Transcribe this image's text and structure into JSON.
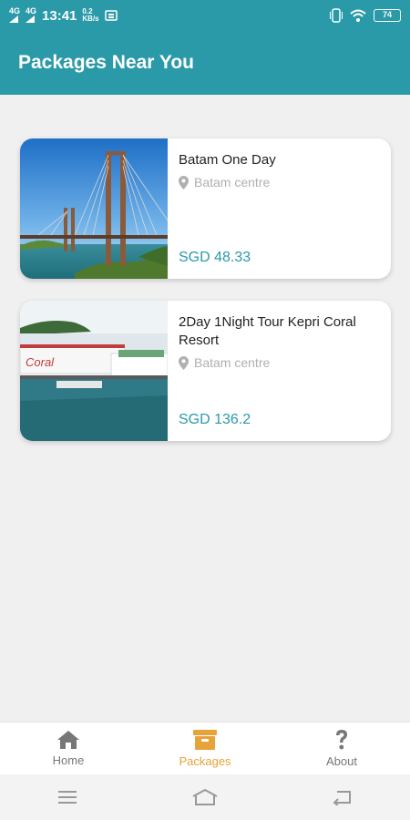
{
  "status_bar": {
    "signal1": "4G",
    "signal2": "4G",
    "time": "13:41",
    "net_speed_value": "0.2",
    "net_speed_unit": "KB/s",
    "battery": "74"
  },
  "header": {
    "title": "Packages Near You"
  },
  "packages": [
    {
      "title": "Batam One Day",
      "location": "Batam centre",
      "price": "SGD 48.33"
    },
    {
      "title": "2Day 1Night Tour Kepri Coral Resort",
      "location": "Batam centre",
      "price": "SGD 136.2",
      "image_sign": "Coral"
    }
  ],
  "bottom_nav": {
    "items": [
      {
        "label": "Home",
        "icon": "home-icon"
      },
      {
        "label": "Packages",
        "icon": "package-icon",
        "active": true
      },
      {
        "label": "About",
        "icon": "question-icon"
      }
    ]
  },
  "colors": {
    "primary": "#2a9aa8",
    "active": "#e8a23a",
    "inactive": "#777777"
  }
}
